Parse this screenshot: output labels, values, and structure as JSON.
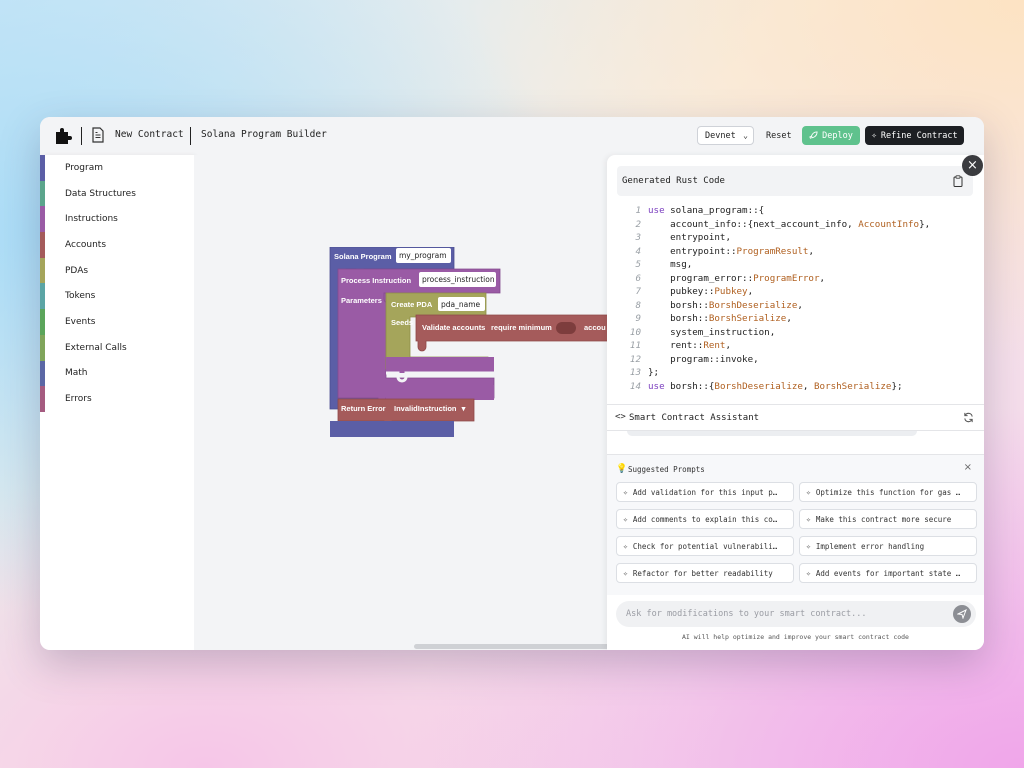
{
  "header": {
    "file_name": "New Contract",
    "app_title": "Solana Program Builder",
    "network": "Devnet",
    "reset_label": "Reset",
    "deploy_label": "Deploy",
    "refine_label": "Refine Contract"
  },
  "sidebar": {
    "items": [
      {
        "label": "Program",
        "color": "#5b5ea6"
      },
      {
        "label": "Data Structures",
        "color": "#5ba58c"
      },
      {
        "label": "Instructions",
        "color": "#9a5ba5"
      },
      {
        "label": "Accounts",
        "color": "#a55b5b"
      },
      {
        "label": "PDAs",
        "color": "#a5a55b"
      },
      {
        "label": "Tokens",
        "color": "#5ba5a5"
      },
      {
        "label": "Events",
        "color": "#5ba55b"
      },
      {
        "label": "External Calls",
        "color": "#80a55b"
      },
      {
        "label": "Math",
        "color": "#5b67a5"
      },
      {
        "label": "Errors",
        "color": "#a55b80"
      }
    ]
  },
  "workspace": {
    "program_label": "Solana Program",
    "program_name": "my_program",
    "process_label": "Process Instruction",
    "process_name": "process_instruction",
    "parameters_label": "Parameters",
    "create_pda_label": "Create PDA",
    "pda_name": "pda_name",
    "seeds_label": "Seeds",
    "validate_label": "Validate accounts",
    "require_label": "require minimum",
    "validate_tail": "accou",
    "return_error_label": "Return Error",
    "error_value": "InvalidInstruction"
  },
  "code_panel": {
    "title": "Generated Rust Code",
    "lines": [
      [
        {
          "t": "kw",
          "v": "use"
        },
        {
          "t": "tx",
          "v": " solana_program::{"
        }
      ],
      [
        {
          "t": "tx",
          "v": "    account_info::{next_account_info, "
        },
        {
          "t": "ty",
          "v": "AccountInfo"
        },
        {
          "t": "tx",
          "v": "},"
        }
      ],
      [
        {
          "t": "tx",
          "v": "    entrypoint,"
        }
      ],
      [
        {
          "t": "tx",
          "v": "    entrypoint::"
        },
        {
          "t": "ty",
          "v": "ProgramResult"
        },
        {
          "t": "tx",
          "v": ","
        }
      ],
      [
        {
          "t": "tx",
          "v": "    msg,"
        }
      ],
      [
        {
          "t": "tx",
          "v": "    program_error::"
        },
        {
          "t": "ty",
          "v": "ProgramError"
        },
        {
          "t": "tx",
          "v": ","
        }
      ],
      [
        {
          "t": "tx",
          "v": "    pubkey::"
        },
        {
          "t": "ty",
          "v": "Pubkey"
        },
        {
          "t": "tx",
          "v": ","
        }
      ],
      [
        {
          "t": "tx",
          "v": "    borsh::"
        },
        {
          "t": "ty",
          "v": "BorshDeserialize"
        },
        {
          "t": "tx",
          "v": ","
        }
      ],
      [
        {
          "t": "tx",
          "v": "    borsh::"
        },
        {
          "t": "ty",
          "v": "BorshSerialize"
        },
        {
          "t": "tx",
          "v": ","
        }
      ],
      [
        {
          "t": "tx",
          "v": "    system_instruction,"
        }
      ],
      [
        {
          "t": "tx",
          "v": "    rent::"
        },
        {
          "t": "ty",
          "v": "Rent"
        },
        {
          "t": "tx",
          "v": ","
        }
      ],
      [
        {
          "t": "tx",
          "v": "    program::invoke,"
        }
      ],
      [
        {
          "t": "tx",
          "v": "};"
        }
      ],
      [
        {
          "t": "kw",
          "v": "use"
        },
        {
          "t": "tx",
          "v": " borsh::{"
        },
        {
          "t": "ty",
          "v": "BorshDeserialize"
        },
        {
          "t": "tx",
          "v": ", "
        },
        {
          "t": "ty",
          "v": "BorshSerialize"
        },
        {
          "t": "tx",
          "v": "};"
        }
      ]
    ]
  },
  "assistant": {
    "title": "Smart Contract Assistant",
    "suggested_title": "Suggested Prompts",
    "prompts": [
      "Add validation for this input p…",
      "Optimize this function for gas …",
      "Add comments to explain this co…",
      "Make this contract more secure",
      "Check for potential vulnerabili…",
      "Implement error handling",
      "Refactor for better readability",
      "Add events for important state …"
    ],
    "input_placeholder": "Ask for modifications to your smart contract...",
    "helper_text": "AI will help optimize and improve your smart contract code"
  }
}
